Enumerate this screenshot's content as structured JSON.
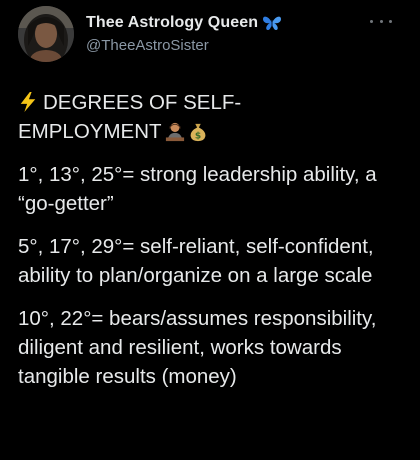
{
  "author": {
    "display_name": "Thee Astrology Queen",
    "handle": "@TheeAstroSister",
    "avatar": "avatar-photo",
    "verified_emoji": "blue-butterfly-icon"
  },
  "menu": {
    "more_icon": "more-options-icon"
  },
  "tweet": {
    "heading_emoji": "lightning-bolt-icon",
    "heading_line1": "DEGREES OF SELF-",
    "heading_line2": "EMPLOYMENT",
    "heading_emojis": [
      "person-at-desk-icon",
      "money-bag-icon"
    ],
    "items": [
      {
        "text": "1°, 13°, 25°= strong leadership ability, a “go-getter”"
      },
      {
        "text": "5°, 17°, 29°= self-reliant, self-confident, ability to plan/organize on a large scale"
      },
      {
        "text": "10°, 22°= bears/assumes responsibility, diligent and resilient, works towards tangible results (money)"
      }
    ]
  },
  "colors": {
    "background": "#000000",
    "text_primary": "#e7e9ea",
    "text_secondary": "#8b98a5",
    "bolt": "#f5c518",
    "butterfly": "#2f7de1"
  }
}
